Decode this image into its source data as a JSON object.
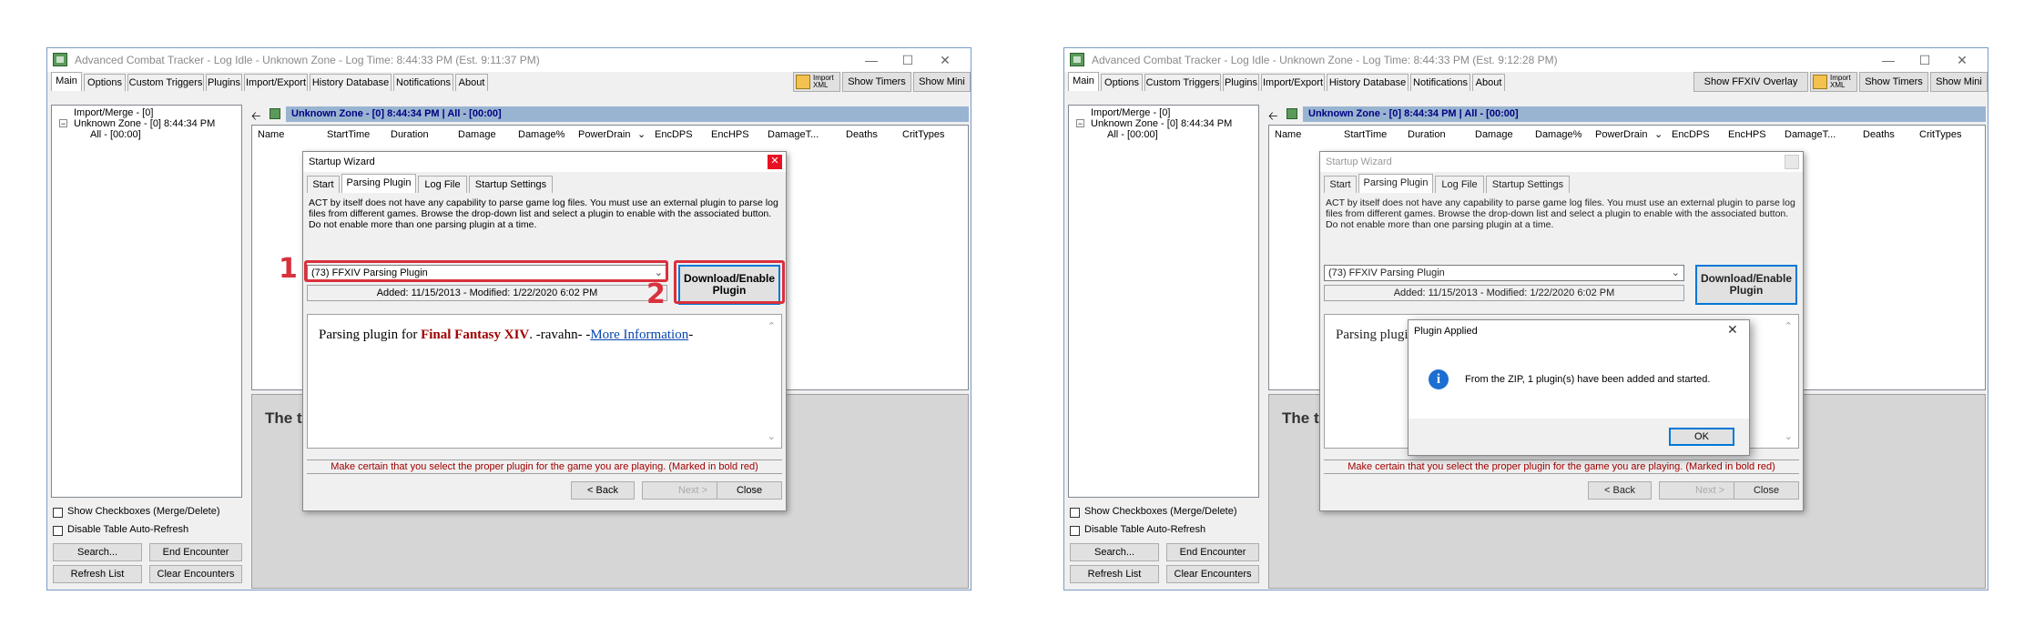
{
  "colors": {
    "accent": "#0078d7",
    "callout_red": "#d9303c",
    "header_bar": "#99b4d1",
    "warn_text": "#a00000"
  },
  "screens": [
    {
      "title": "Advanced Combat Tracker - Log Idle - Unknown Zone - Log Time: 8:44:33 PM (Est. 9:11:37 PM)",
      "tabs": [
        "Main",
        "Options",
        "Custom Triggers",
        "Plugins",
        "Import/Export",
        "History Database",
        "Notifications",
        "About"
      ],
      "toolbar": {
        "overlay": "",
        "import_xml_line1": "Import",
        "import_xml_line2": "XML",
        "show_timers": "Show Timers",
        "show_mini": "Show Mini"
      },
      "tree": [
        "Import/Merge - [0]",
        "Unknown Zone - [0] 8:44:34 PM",
        "All - [00:00]"
      ],
      "encounter_header": "Unknown Zone - [0] 8:44:34 PM | All - [00:00]",
      "columns": [
        "Name",
        "StartTime",
        "Duration",
        "Damage",
        "Damage%",
        "PowerDrain",
        "EncDPS",
        "EncHPS",
        "DamageT...",
        "Deaths",
        "CritTypes"
      ],
      "big_text": "The t",
      "checkboxes": [
        "Show Checkboxes (Merge/Delete)",
        "Disable Table Auto-Refresh"
      ],
      "bottom_buttons": [
        "Search...",
        "End Encounter",
        "Refresh List",
        "Clear Encounters"
      ],
      "wizard": {
        "title": "Startup Wizard",
        "tabs": [
          "Start",
          "Parsing Plugin",
          "Log File",
          "Startup Settings"
        ],
        "description": "ACT by itself does not have any capability to parse game log files.  You must use an external plugin to parse log files from different games.  Browse the drop-down list and select a plugin to enable with the associated button.  Do not enable more than one parsing plugin at a time.",
        "combo_value": "(73) FFXIV Parsing Plugin",
        "added_info": "Added: 11/15/2013 - Modified: 1/22/2020 6:02 PM",
        "download_line1": "Download/Enable",
        "download_line2": "Plugin",
        "plugin_desc_prefix": "Parsing plugin for ",
        "plugin_desc_game": "Final Fantasy XIV",
        "plugin_desc_author": ". -ravahn- -",
        "plugin_desc_link": "More Information",
        "plugin_desc_suffix": "-",
        "warning": "Make certain that you select the proper plugin for the game you are playing.  (Marked in bold red)",
        "back": "< Back",
        "next": "Next >",
        "close": "Close"
      },
      "callouts": [
        "1",
        "2"
      ]
    },
    {
      "title": "Advanced Combat Tracker - Log Idle - Unknown Zone - Log Time: 8:44:33 PM (Est. 9:12:28 PM)",
      "tabs": [
        "Main",
        "Options",
        "Custom Triggers",
        "Plugins",
        "Import/Export",
        "History Database",
        "Notifications",
        "About"
      ],
      "toolbar": {
        "overlay": "Show FFXIV Overlay",
        "import_xml_line1": "Import",
        "import_xml_line2": "XML",
        "show_timers": "Show Timers",
        "show_mini": "Show Mini"
      },
      "tree": [
        "Import/Merge - [0]",
        "Unknown Zone - [0] 8:44:34 PM",
        "All - [00:00]"
      ],
      "encounter_header": "Unknown Zone - [0] 8:44:34 PM | All - [00:00]",
      "columns": [
        "Name",
        "StartTime",
        "Duration",
        "Damage",
        "Damage%",
        "PowerDrain",
        "EncDPS",
        "EncHPS",
        "DamageT...",
        "Deaths",
        "CritTypes"
      ],
      "big_text": "The t",
      "checkboxes": [
        "Show Checkboxes (Merge/Delete)",
        "Disable Table Auto-Refresh"
      ],
      "bottom_buttons": [
        "Search...",
        "End Encounter",
        "Refresh List",
        "Clear Encounters"
      ],
      "wizard": {
        "title": "Startup Wizard",
        "tabs": [
          "Start",
          "Parsing Plugin",
          "Log File",
          "Startup Settings"
        ],
        "description": "ACT by itself does not have any capability to parse game log files.  You must use an external plugin to parse log files from different games.  Browse the drop-down list and select a plugin to enable with the associated button.  Do not enable more than one parsing plugin at a time.",
        "combo_value": "(73) FFXIV Parsing Plugin",
        "added_info": "Added: 11/15/2013 - Modified: 1/22/2020 6:02 PM",
        "download_line1": "Download/Enable",
        "download_line2": "Plugin",
        "plugin_desc_prefix": "Parsing plugi",
        "warning": "Make certain that you select the proper plugin for the game you are playing.  (Marked in bold red)",
        "back": "< Back",
        "next": "Next >",
        "close": "Close"
      },
      "msgbox": {
        "title": "Plugin Applied",
        "message": "From the ZIP, 1 plugin(s) have been added and started.",
        "ok": "OK"
      }
    }
  ]
}
